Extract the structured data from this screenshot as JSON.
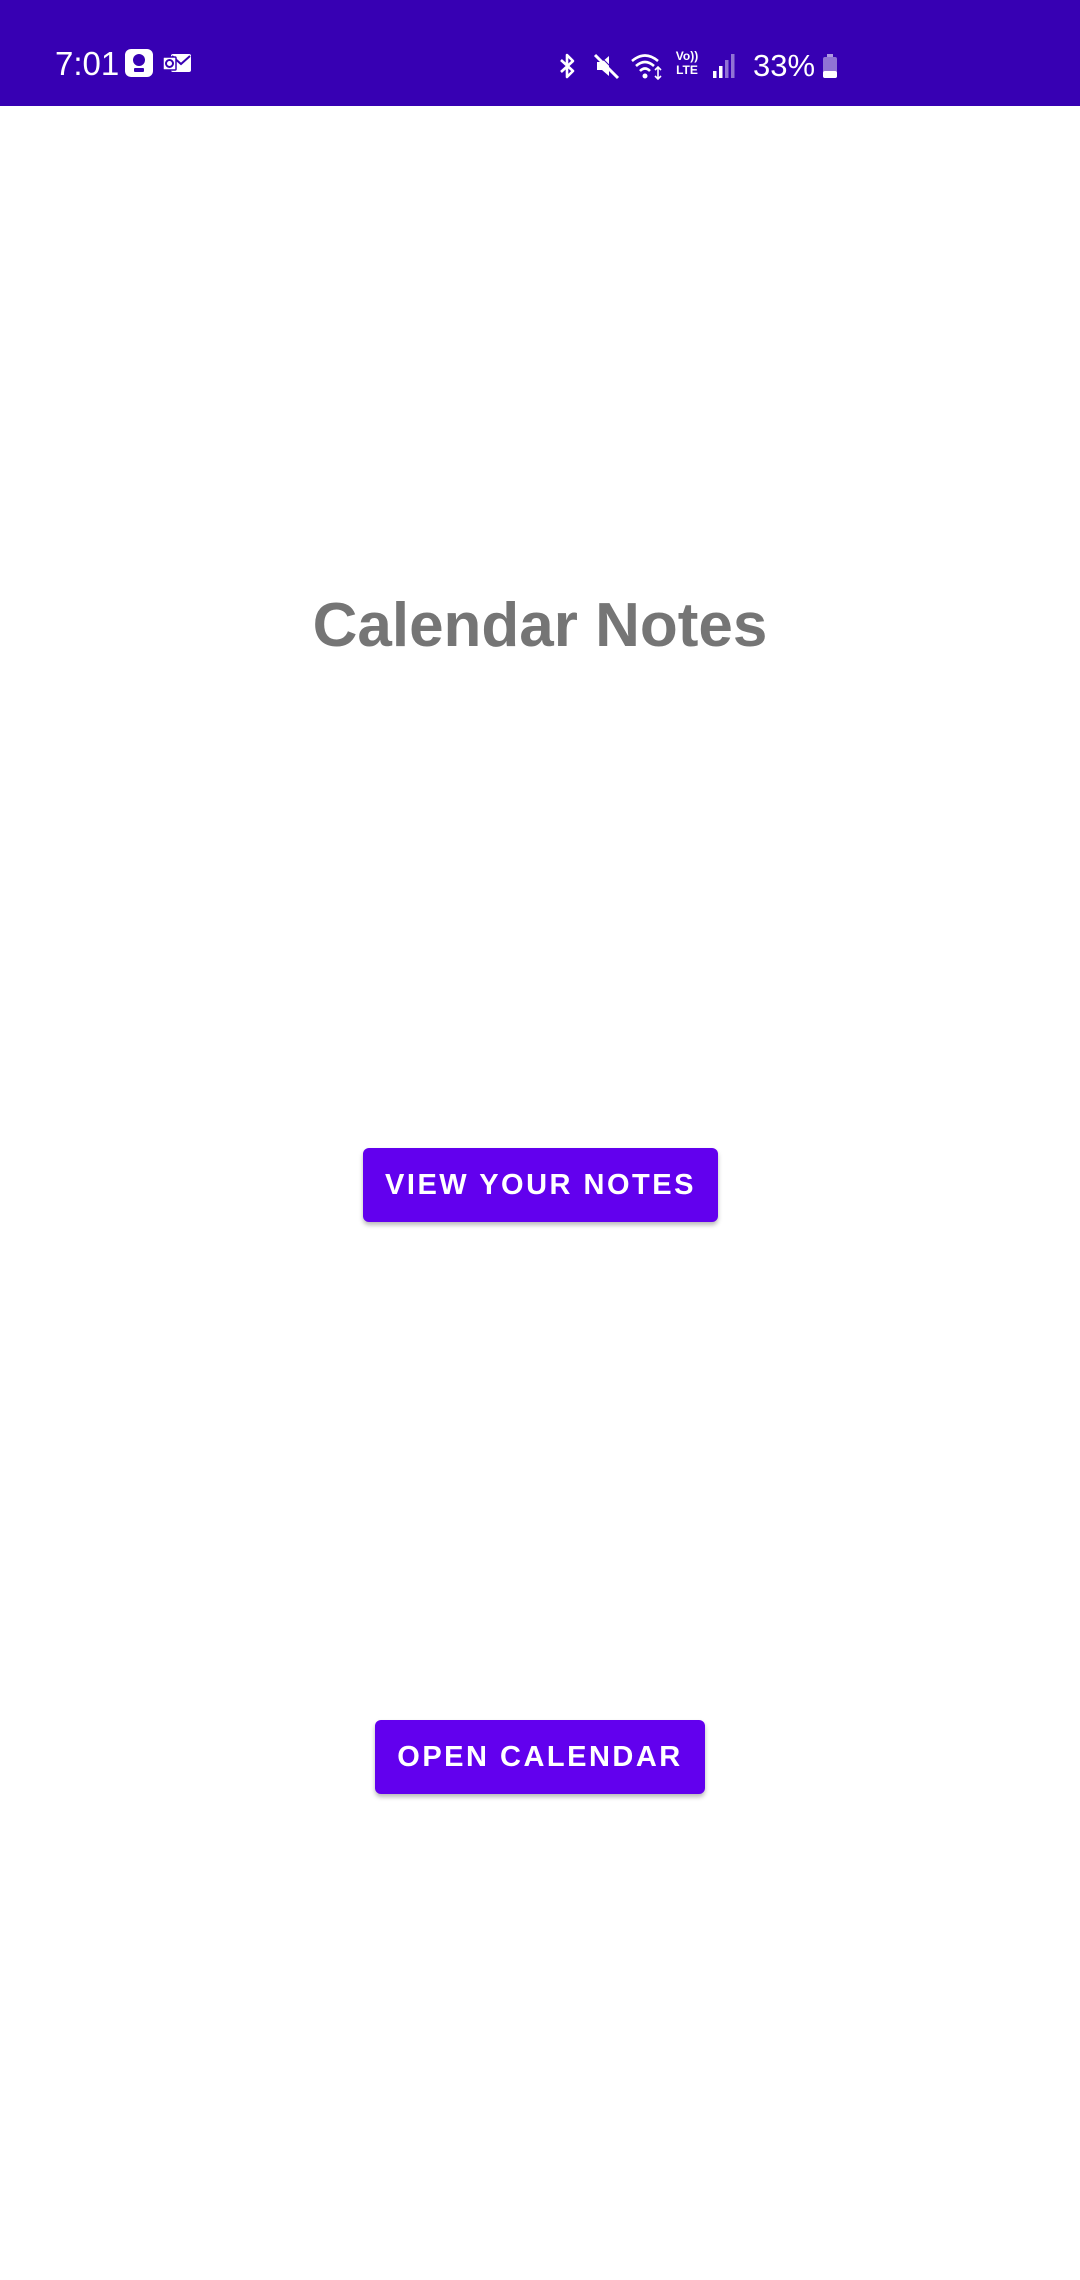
{
  "status_bar": {
    "time": "7:01",
    "battery_percent": "33%",
    "background_color": "#3700B3",
    "left_icons": [
      "assistant-notification-icon",
      "outlook-notification-icon"
    ],
    "right_icons": [
      "bluetooth-icon",
      "mute-icon",
      "wifi-icon",
      "volte-icon",
      "signal-icon",
      "battery-icon"
    ],
    "volte_label_top": "Vo))",
    "volte_label_bottom": "LTE",
    "battery_level": 0.33
  },
  "main": {
    "title": "Calendar Notes",
    "view_notes_button": "VIEW YOUR NOTES",
    "open_calendar_button": "OPEN CALENDAR",
    "accent_color": "#6200EE",
    "title_color": "#757575"
  }
}
